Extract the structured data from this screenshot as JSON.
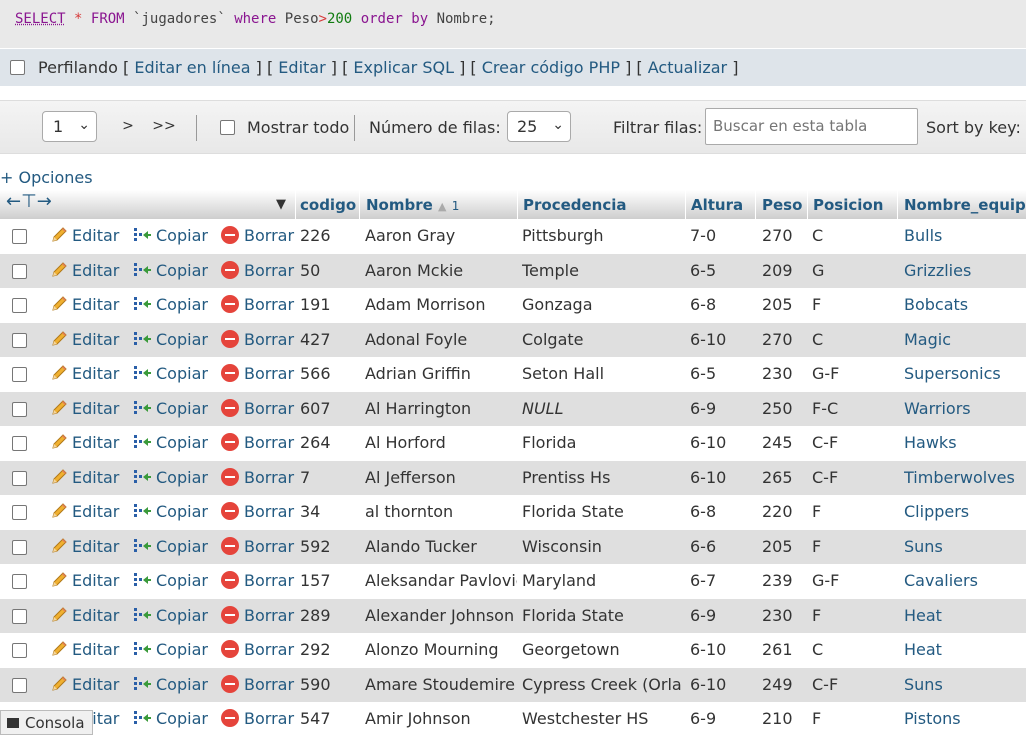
{
  "query": {
    "select": "SELECT",
    "star": "*",
    "from": "FROM",
    "table": "`jugadores`",
    "where": "where",
    "field": "Peso",
    "op": ">",
    "value": "200",
    "order": "order",
    "by": "by",
    "orderfield": "Nombre;"
  },
  "profiling": {
    "label": "Perfilando",
    "links": [
      "Editar en línea",
      "Editar",
      "Explicar SQL",
      "Crear código PHP",
      "Actualizar"
    ]
  },
  "nav": {
    "page": "1",
    "next": ">",
    "last": ">>",
    "show_all": "Mostrar todo",
    "rows_label": "Número de filas:",
    "rows_value": "25",
    "filter_label": "Filtrar filas:",
    "filter_placeholder": "Buscar en esta tabla",
    "sort_label": "Sort by key:"
  },
  "options_label": "+ Opciones",
  "actions": {
    "edit": "Editar",
    "copy": "Copiar",
    "delete": "Borrar"
  },
  "columns": [
    "codigo",
    "Nombre",
    "Procedencia",
    "Altura",
    "Peso",
    "Posicion",
    "Nombre_equipo"
  ],
  "sort_indicator": "1",
  "rows": [
    [
      "226",
      "Aaron Gray",
      "Pittsburgh",
      "7-0",
      "270",
      "C",
      "Bulls"
    ],
    [
      "50",
      "Aaron Mckie",
      "Temple",
      "6-5",
      "209",
      "G",
      "Grizzlies"
    ],
    [
      "191",
      "Adam Morrison",
      "Gonzaga",
      "6-8",
      "205",
      "F",
      "Bobcats"
    ],
    [
      "427",
      "Adonal Foyle",
      "Colgate",
      "6-10",
      "270",
      "C",
      "Magic"
    ],
    [
      "566",
      "Adrian Griffin",
      "Seton Hall",
      "6-5",
      "230",
      "G-F",
      "Supersonics"
    ],
    [
      "607",
      "Al Harrington",
      "NULL",
      "6-9",
      "250",
      "F-C",
      "Warriors"
    ],
    [
      "264",
      "Al Horford",
      "Florida",
      "6-10",
      "245",
      "C-F",
      "Hawks"
    ],
    [
      "7",
      "Al Jefferson",
      "Prentiss Hs",
      "6-10",
      "265",
      "C-F",
      "Timberwolves"
    ],
    [
      "34",
      "al thornton",
      "Florida State",
      "6-8",
      "220",
      "F",
      "Clippers"
    ],
    [
      "592",
      "Alando Tucker",
      "Wisconsin",
      "6-6",
      "205",
      "F",
      "Suns"
    ],
    [
      "157",
      "Aleksandar Pavlovic",
      "Maryland",
      "6-7",
      "239",
      "G-F",
      "Cavaliers"
    ],
    [
      "289",
      "Alexander Johnson",
      "Florida State",
      "6-9",
      "230",
      "F",
      "Heat"
    ],
    [
      "292",
      "Alonzo Mourning",
      "Georgetown",
      "6-10",
      "261",
      "C",
      "Heat"
    ],
    [
      "590",
      "Amare Stoudemire",
      "Cypress Creek (Orlando)",
      "6-10",
      "249",
      "C-F",
      "Suns"
    ],
    [
      "547",
      "Amir Johnson",
      "Westchester HS",
      "6-9",
      "210",
      "F",
      "Pistons"
    ]
  ],
  "console_label": "Consola"
}
